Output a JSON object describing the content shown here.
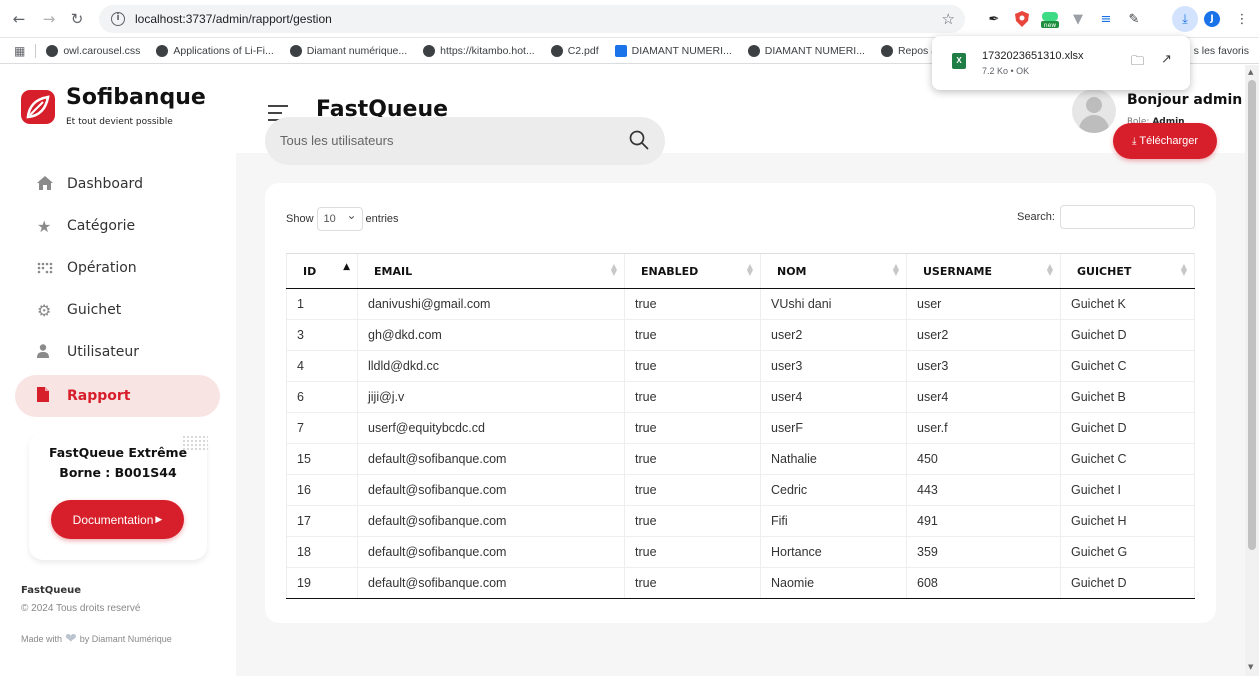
{
  "browser": {
    "url": "localhost:3737/admin/rapport/gestion",
    "bookmarks": [
      "owl.carousel.css",
      "Applications of Li-Fi...",
      "Diamant numérique...",
      "https://kitambo.hot...",
      "C2.pdf",
      "DIAMANT NUMERI...",
      "DIAMANT NUMERI...",
      "Repos asbl - Ren"
    ],
    "bookmarks_right": "s les favoris",
    "download": {
      "filename": "1732023651310.xlsx",
      "meta": "7.2 Ko • OK"
    },
    "colors": {
      "accent": "#1a73e8"
    }
  },
  "sidebar": {
    "brand": "Sofibanque",
    "tagline": "Et tout devient possible",
    "items": [
      {
        "label": "Dashboard",
        "icon": "home-icon"
      },
      {
        "label": "Catégorie",
        "icon": "star-icon"
      },
      {
        "label": "Opération",
        "icon": "grid-dots-icon"
      },
      {
        "label": "Guichet",
        "icon": "gear-icon"
      },
      {
        "label": "Utilisateur",
        "icon": "user-icon"
      },
      {
        "label": "Rapport",
        "icon": "file-icon",
        "active": true
      }
    ],
    "card": {
      "line1": "FastQueue Extrême",
      "line2": "Borne : B001S44",
      "button": "Documentation"
    },
    "footer": {
      "brand": "FastQueue",
      "copyright": "© 2024 Tous droits reservé",
      "made_with": "Made with",
      "by": "by Diamant Numérique"
    }
  },
  "header": {
    "title": "FastQueue",
    "greeting": "Bonjour admin",
    "role_label": "Role:",
    "role_value": "Admin"
  },
  "main": {
    "search_placeholder": "Tous les utilisateurs",
    "download_button": "Télécharger",
    "table": {
      "show_label": "Show",
      "entries_value": "10",
      "entries_label": "entries",
      "search_label": "Search:",
      "columns": [
        "ID",
        "EMAIL",
        "ENABLED",
        "NOM",
        "USERNAME",
        "GUICHET"
      ],
      "rows": [
        [
          "1",
          "danivushi@gmail.com",
          "true",
          "VUshi dani",
          "user",
          "Guichet K"
        ],
        [
          "3",
          "gh@dkd.com",
          "true",
          "user2",
          "user2",
          "Guichet D"
        ],
        [
          "4",
          "lldld@dkd.cc",
          "true",
          "user3",
          "user3",
          "Guichet C"
        ],
        [
          "6",
          "jiji@j.v",
          "true",
          "user4",
          "user4",
          "Guichet B"
        ],
        [
          "7",
          "userf@equitybcdc.cd",
          "true",
          "userF",
          "user.f",
          "Guichet D"
        ],
        [
          "15",
          "default@sofibanque.com",
          "true",
          "Nathalie",
          "450",
          "Guichet C"
        ],
        [
          "16",
          "default@sofibanque.com",
          "true",
          "Cedric",
          "443",
          "Guichet I"
        ],
        [
          "17",
          "default@sofibanque.com",
          "true",
          "Fifi",
          "491",
          "Guichet H"
        ],
        [
          "18",
          "default@sofibanque.com",
          "true",
          "Hortance",
          "359",
          "Guichet G"
        ],
        [
          "19",
          "default@sofibanque.com",
          "true",
          "Naomie",
          "608",
          "Guichet D"
        ]
      ]
    }
  },
  "colors": {
    "brand_red": "#d71f2b",
    "active_bg": "#f9e4e4"
  }
}
